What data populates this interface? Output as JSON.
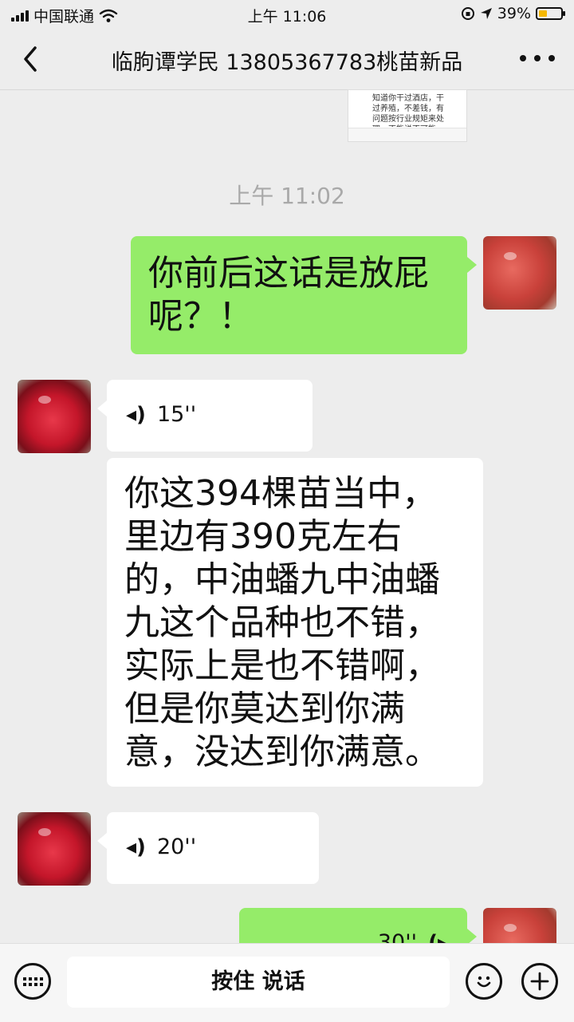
{
  "status_bar": {
    "carrier": "中国联通",
    "time": "上午 11:06",
    "battery_percent": "39%",
    "battery_level": 0.39,
    "battery_color": "#f5b800"
  },
  "header": {
    "title": "临朐谭学民 13805367783桃苗新品"
  },
  "thumbnail": {
    "text": "知道你干过酒店，干过养殖，不差钱，有问题按行业规矩来处理，不能说不可能"
  },
  "timestamp": "上午 11:02",
  "messages": [
    {
      "side": "right",
      "type": "text",
      "text": "你前后这话是放屁\n呢？！"
    },
    {
      "side": "left",
      "type": "voice",
      "duration": "15''"
    },
    {
      "side": "left",
      "type": "text",
      "text": "你这394棵苗当中，\n里边有390克左右\n的，中油蟠九中油蟠\n九这个品种也不错，\n实际上是也不错啊，\n但是你莫达到你满\n意，没达到你满意。"
    },
    {
      "side": "left",
      "type": "voice",
      "duration": "20''"
    },
    {
      "side": "right",
      "type": "voice",
      "duration": "30''"
    }
  ],
  "input_bar": {
    "talk_label": "按住 说话"
  },
  "colors": {
    "self_bubble": "#95ec69",
    "other_bubble": "#ffffff",
    "background": "#ededed"
  }
}
